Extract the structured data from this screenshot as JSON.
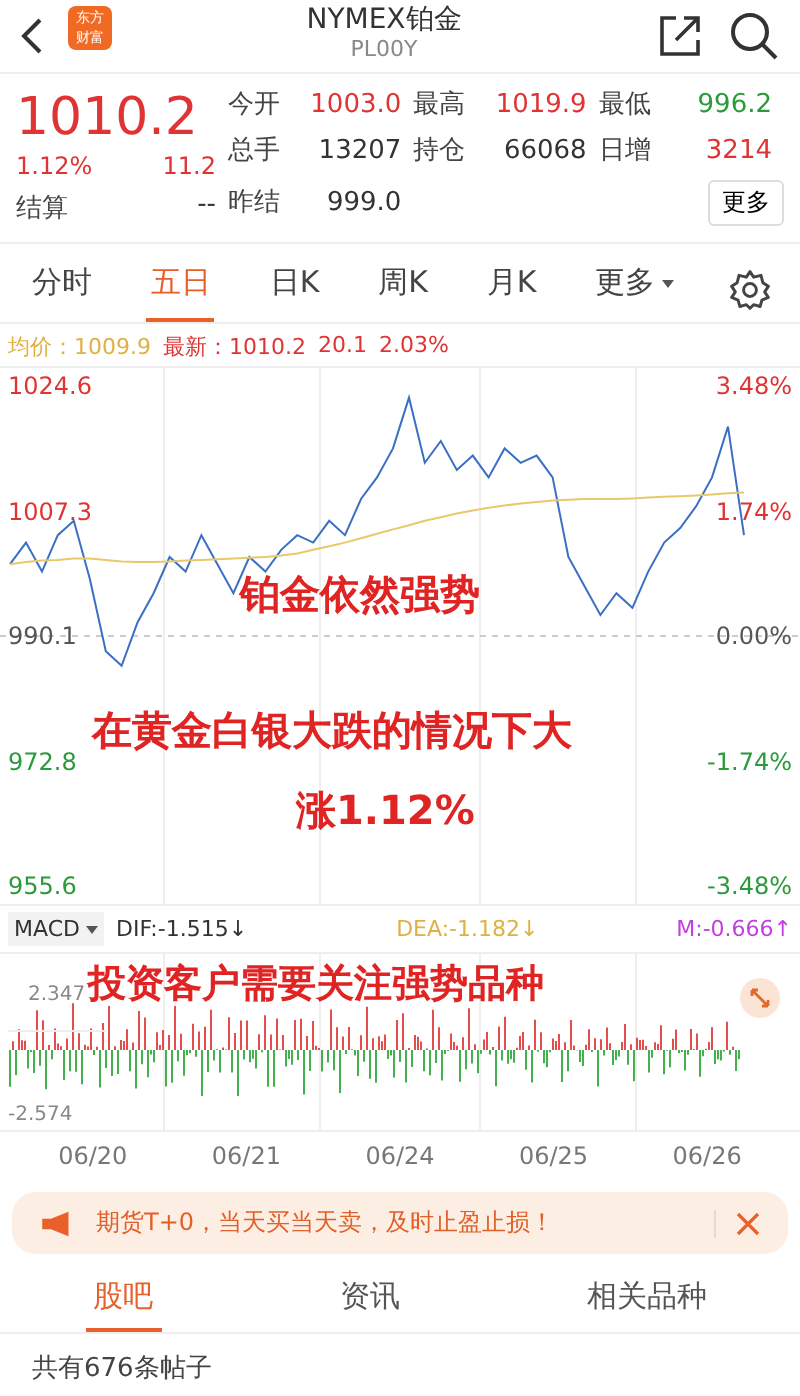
{
  "header": {
    "title": "NYMEX铂金",
    "code": "PL00Y",
    "logo_lines": [
      "东方",
      "财富"
    ]
  },
  "quote": {
    "price": "1010.2",
    "change_pct": "1.12%",
    "change": "11.2",
    "color": "#e03434",
    "settle": {
      "label": "结算",
      "value": "--"
    },
    "fields": [
      {
        "label": "今开",
        "value": "1003.0",
        "color": "#e03434"
      },
      {
        "label": "最高",
        "value": "1019.9",
        "color": "#e03434"
      },
      {
        "label": "最低",
        "value": "996.2",
        "color": "#2a9a3a"
      },
      {
        "label": "总手",
        "value": "13207",
        "color": "#333333"
      },
      {
        "label": "持仓",
        "value": "66068",
        "color": "#333333"
      },
      {
        "label": "日增",
        "value": "3214",
        "color": "#e03434"
      },
      {
        "label": "昨结",
        "value": "999.0",
        "color": "#333333"
      }
    ],
    "more_button": "更多"
  },
  "period_tabs": [
    {
      "label": "分时",
      "selected": false
    },
    {
      "label": "五日",
      "selected": true
    },
    {
      "label": "日K",
      "selected": false
    },
    {
      "label": "周K",
      "selected": false
    },
    {
      "label": "月K",
      "selected": false
    },
    {
      "label": "更多",
      "selected": false
    }
  ],
  "info": {
    "avg_label": "均价：",
    "avg": "1009.9",
    "latest_label": "最新：",
    "latest": "1010.2",
    "change": "20.1",
    "change_pct": "2.03%"
  },
  "chart": {
    "chart_data": {
      "type": "line",
      "ylim": [
        955.6,
        1024.6
      ],
      "ref_lines": [
        {
          "axis": "y",
          "value": 990.1
        }
      ],
      "yticks": [
        {
          "value": 1024.6,
          "label": "1024.6"
        },
        {
          "value": 1007.3,
          "label": "1007.3"
        },
        {
          "value": 990.1,
          "label": "990.1"
        },
        {
          "value": 972.8,
          "label": "972.8"
        },
        {
          "value": 955.6,
          "label": "955.6"
        }
      ],
      "series": [
        {
          "color": "#3a6fc4",
          "values": [
            1000,
            1003,
            999,
            1004,
            1006,
            998,
            988,
            986,
            992,
            996,
            1001,
            999,
            1004,
            1000,
            996,
            1001,
            999,
            1002,
            1004,
            1003,
            1006,
            1004,
            1009,
            1012,
            1016,
            1023,
            1014,
            1017,
            1013,
            1015,
            1012,
            1016,
            1014,
            1015,
            1012,
            1001,
            997,
            993,
            996,
            994,
            999,
            1003,
            1005,
            1008,
            1012,
            1019,
            1004
          ]
        },
        {
          "color": "#e8c96a",
          "values": [
            1000,
            1000.3,
            1000.5,
            1000.6,
            1000.8,
            1000.8,
            1000.6,
            1000.4,
            1000.3,
            1000.3,
            1000.4,
            1000.5,
            1000.6,
            1000.7,
            1000.8,
            1000.9,
            1001,
            1001.2,
            1001.5,
            1002,
            1002.5,
            1003,
            1003.6,
            1004.2,
            1004.8,
            1005.4,
            1006,
            1006.5,
            1007,
            1007.4,
            1007.8,
            1008.1,
            1008.4,
            1008.6,
            1008.8,
            1008.9,
            1009,
            1009,
            1009,
            1009.1,
            1009.2,
            1009.3,
            1009.4,
            1009.5,
            1009.6,
            1009.8,
            1009.9
          ]
        }
      ]
    },
    "right_ticks": [
      {
        "label": "3.48%",
        "color": "#e03434"
      },
      {
        "label": "1.74%",
        "color": "#e03434"
      },
      {
        "label": "0.00%",
        "color": "#555555"
      },
      {
        "label": "-1.74%",
        "color": "#2a9a3a"
      },
      {
        "label": "-3.48%",
        "color": "#2a9a3a"
      }
    ],
    "captions": [
      "铂金依然强势",
      "在黄金白银大跌的情况下大",
      "涨1.12%"
    ]
  },
  "macd": {
    "selector": "MACD",
    "dif": "DIF:-1.515↓",
    "dea": "DEA:-1.182↓",
    "m": "M:-0.666↑",
    "max": "2.347",
    "min": "-2.574",
    "caption": "投资客户需要关注强势品种"
  },
  "dates": [
    "06/20",
    "06/21",
    "06/24",
    "06/25",
    "06/26"
  ],
  "banner": {
    "text": "期货T+0，当天买当天卖，及时止盈止损！"
  },
  "bottom_tabs": [
    {
      "label": "股吧",
      "selected": true
    },
    {
      "label": "资讯",
      "selected": false
    },
    {
      "label": "相关品种",
      "selected": false
    }
  ],
  "post_count": "共有676条帖子"
}
